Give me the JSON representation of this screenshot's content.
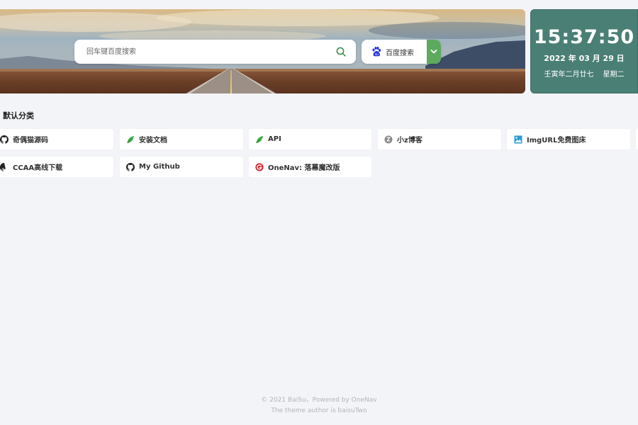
{
  "search": {
    "placeholder": "回车键百度搜索",
    "engine_label": "百度搜索",
    "engine_icon": "baidu-paw-icon"
  },
  "clock": {
    "time": "15:37:50",
    "date": "2022 年 03 月 29 日",
    "lunar": "壬寅年二月廿七",
    "weekday": "星期二"
  },
  "category": {
    "title": "默认分类",
    "links": [
      {
        "label": "奇偶猫源码",
        "icon": "github-icon"
      },
      {
        "label": "安装文档",
        "icon": "leaf-icon"
      },
      {
        "label": "API",
        "icon": "leaf-icon"
      },
      {
        "label": "小z博客",
        "icon": "z-circle-icon"
      },
      {
        "label": "ImgURL免费图床",
        "icon": "image-icon"
      },
      {
        "label": "CCAA高线下载",
        "icon": "github-icon"
      },
      {
        "label": "My Github",
        "icon": "github-icon"
      },
      {
        "label": "OneNav: 落幕魔改版",
        "icon": "onenav-icon"
      }
    ]
  },
  "footer": {
    "line1": "© 2021 BaiSu，Powered by OneNav",
    "line2": "The theme author is baisuTwo"
  },
  "colors": {
    "background": "#f3f4f8",
    "clock_bg": "#4a7f76",
    "accent_green": "#5daa5f",
    "baidu_blue": "#2932e1",
    "onenav_red": "#d9282f"
  }
}
